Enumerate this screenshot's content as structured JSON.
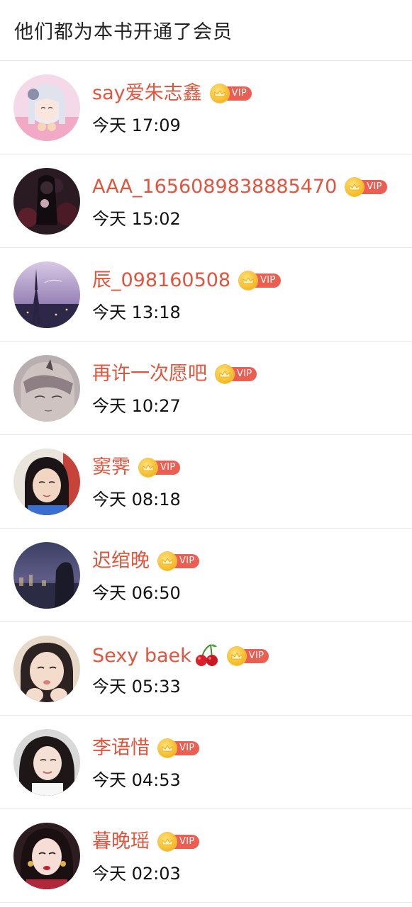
{
  "header": {
    "title": "他们都为本书开通了会员"
  },
  "vip_text": "VIP",
  "colors": {
    "name": "#e0553e",
    "vip_badge": "#ec5e52",
    "crown": "#f5b921"
  },
  "members": [
    {
      "name": "say爱朱志鑫",
      "time": "今天 17:09",
      "avatar_icon": "anime-girl-avatar"
    },
    {
      "name": "AAA_1656089838885470",
      "time": "今天 15:02",
      "avatar_icon": "dark-portrait-avatar"
    },
    {
      "name": "辰_098160508",
      "time": "今天 13:18",
      "avatar_icon": "eiffel-tower-avatar"
    },
    {
      "name": "再许一次愿吧",
      "time": "今天 10:27",
      "avatar_icon": "anime-boy-avatar"
    },
    {
      "name": "窦霁",
      "time": "今天 08:18",
      "avatar_icon": "girl-photo-avatar"
    },
    {
      "name": "迟绾晚",
      "time": "今天 06:50",
      "avatar_icon": "night-scene-avatar"
    },
    {
      "name": "Sexy baek",
      "name_emoji": "cherry-icon",
      "time": "今天 05:33",
      "avatar_icon": "girl-photo-avatar"
    },
    {
      "name": "李语惜",
      "time": "今天 04:53",
      "avatar_icon": "woman-photo-avatar"
    },
    {
      "name": "暮晚瑶",
      "time": "今天 02:03",
      "avatar_icon": "woman-photo-avatar"
    }
  ]
}
